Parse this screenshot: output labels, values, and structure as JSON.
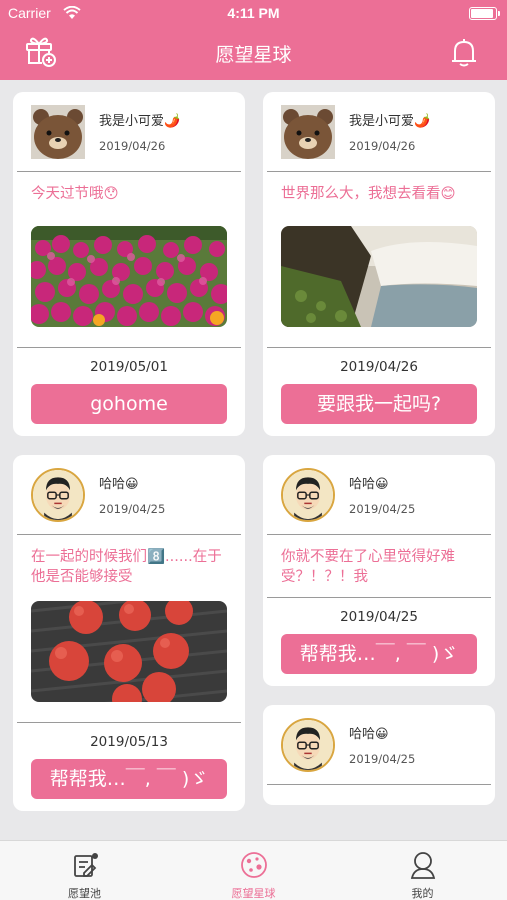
{
  "status_bar": {
    "carrier": "Carrier",
    "time": "4:11 PM",
    "battery_level": 0.92
  },
  "nav": {
    "title": "愿望星球",
    "left_icon": "gift-add-icon",
    "right_icon": "bell-icon"
  },
  "colors": {
    "accent": "#ec6f96",
    "background": "#e8e8ea"
  },
  "feed": {
    "left": [
      {
        "user": "我是小可爱🌶️",
        "date": "2019/04/26",
        "text": "今天过节哦😯",
        "image": "pink-flowers-photo",
        "footer_date": "2019/05/01",
        "button": "gohome",
        "avatar": "bear-avatar"
      },
      {
        "user": "哈哈😀",
        "date": "2019/04/25",
        "text": "在一起的时候我们8️⃣......在于他是否能够接受",
        "image": "lychee-photo",
        "footer_date": "2019/05/13",
        "button": "帮帮我…￣, ￣ )ゞ",
        "avatar": "glasses-man-avatar"
      }
    ],
    "right": [
      {
        "user": "我是小可爱🌶️",
        "date": "2019/04/26",
        "text": "世界那么大，我想去看看😊",
        "image": "waterfall-photo",
        "footer_date": "2019/04/26",
        "button": "要跟我一起吗?",
        "avatar": "bear-avatar"
      },
      {
        "user": "哈哈😀",
        "date": "2019/04/25",
        "text": "你就不要在了心里觉得好难受？！？！我",
        "footer_date": "2019/04/25",
        "button": "帮帮我…￣, ￣ )ゞ",
        "avatar": "glasses-man-avatar"
      },
      {
        "user": "哈哈😀",
        "date": "2019/04/25",
        "avatar": "glasses-man-avatar"
      }
    ]
  },
  "tabs": [
    {
      "label": "愿望池",
      "icon": "wish-pool-icon",
      "active": false
    },
    {
      "label": "愿望星球",
      "icon": "planet-icon",
      "active": true
    },
    {
      "label": "我的",
      "icon": "profile-icon",
      "active": false
    }
  ]
}
